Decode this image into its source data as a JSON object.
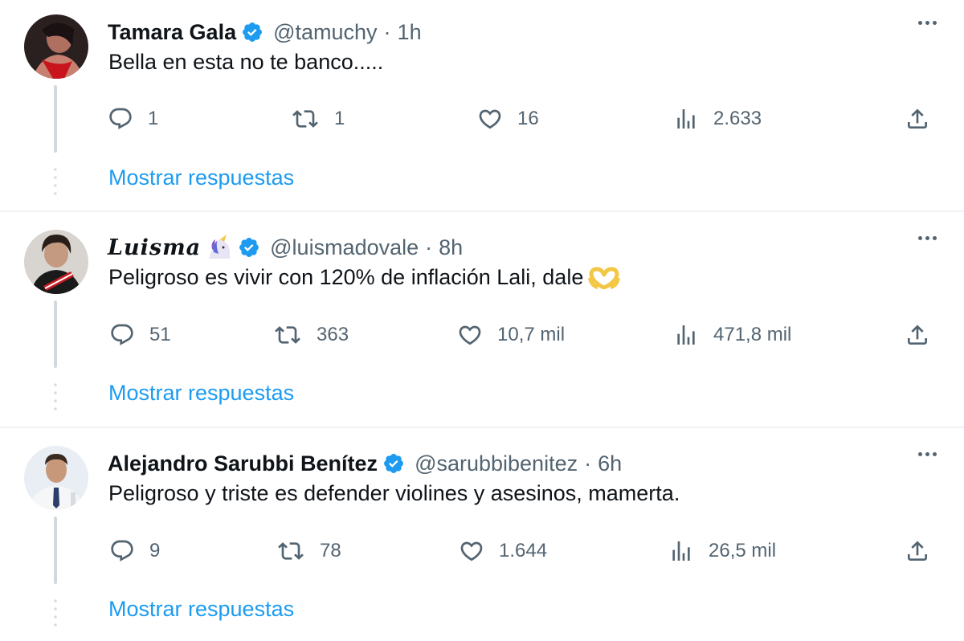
{
  "colors": {
    "link": "#1d9bf0",
    "secondary": "#536471",
    "verified": "#1d9bf0",
    "divider": "#eff3f4",
    "thread": "#cfd9de"
  },
  "icons": {
    "reply": "reply-icon",
    "retweet": "retweet-icon",
    "like": "heart-icon",
    "views": "views-icon",
    "share": "share-icon",
    "more": "more-dots-icon",
    "verified": "verified-badge-icon"
  },
  "tweets": [
    {
      "name": "Tamara Gala",
      "handle": "@tamuchy",
      "dot": "·",
      "time": "1h",
      "text": "Bella en esta no te banco.....",
      "replies": "1",
      "retweets": "1",
      "likes": "16",
      "views": "2.633",
      "show_replies": "Mostrar respuestas"
    },
    {
      "name": "Luisma",
      "handle": "@luismadovale",
      "dot": "·",
      "time": "8h",
      "text": "Peligroso es vivir con 120% de inflación Lali, dale",
      "replies": "51",
      "retweets": "363",
      "likes": "10,7 mil",
      "views": "471,8 mil",
      "show_replies": "Mostrar respuestas"
    },
    {
      "name": "Alejandro Sarubbi Benítez",
      "handle": "@sarubbibenitez",
      "dot": "·",
      "time": "6h",
      "text": "Peligroso y triste es defender violines y asesinos, mamerta.",
      "replies": "9",
      "retweets": "78",
      "likes": "1.644",
      "views": "26,5 mil",
      "show_replies": "Mostrar respuestas"
    }
  ]
}
